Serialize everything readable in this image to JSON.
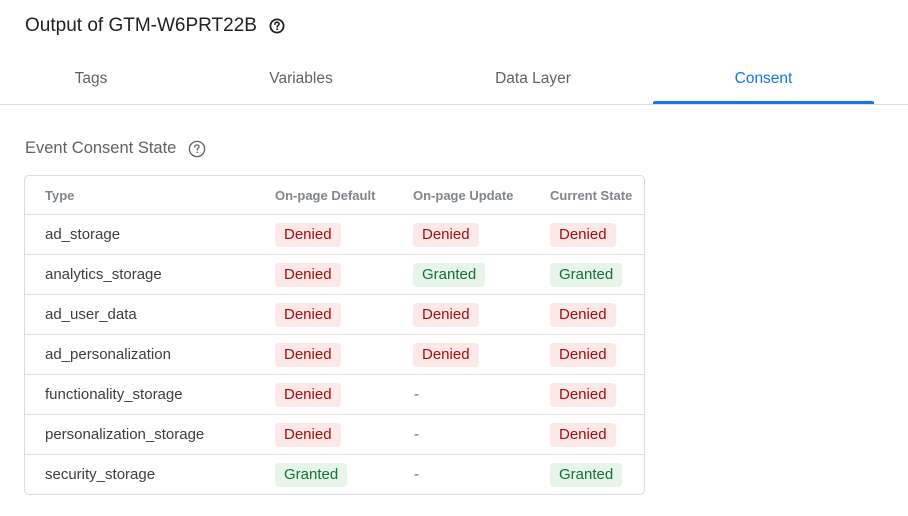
{
  "header": {
    "title": "Output of GTM-W6PRT22B"
  },
  "tabs": [
    {
      "label": "Tags",
      "active": false
    },
    {
      "label": "Variables",
      "active": false
    },
    {
      "label": "Data Layer",
      "active": false
    },
    {
      "label": "Consent",
      "active": true
    }
  ],
  "section": {
    "title": "Event Consent State"
  },
  "table": {
    "columns": [
      "Type",
      "On-page Default",
      "On-page Update",
      "Current State"
    ],
    "rows": [
      {
        "type": "ad_storage",
        "default": "Denied",
        "update": "Denied",
        "current": "Denied"
      },
      {
        "type": "analytics_storage",
        "default": "Denied",
        "update": "Granted",
        "current": "Granted"
      },
      {
        "type": "ad_user_data",
        "default": "Denied",
        "update": "Denied",
        "current": "Denied"
      },
      {
        "type": "ad_personalization",
        "default": "Denied",
        "update": "Denied",
        "current": "Denied"
      },
      {
        "type": "functionality_storage",
        "default": "Denied",
        "update": "-",
        "current": "Denied"
      },
      {
        "type": "personalization_storage",
        "default": "Denied",
        "update": "-",
        "current": "Denied"
      },
      {
        "type": "security_storage",
        "default": "Granted",
        "update": "-",
        "current": "Granted"
      }
    ]
  },
  "colors": {
    "accent": "#1a73e8",
    "denied_bg": "#fce8e6",
    "denied_text": "#a50e0e",
    "granted_bg": "#e6f4ea",
    "granted_text": "#137333"
  },
  "icons": {
    "title_help": "help-circle-icon",
    "section_help": "help-circle-outline-icon"
  }
}
